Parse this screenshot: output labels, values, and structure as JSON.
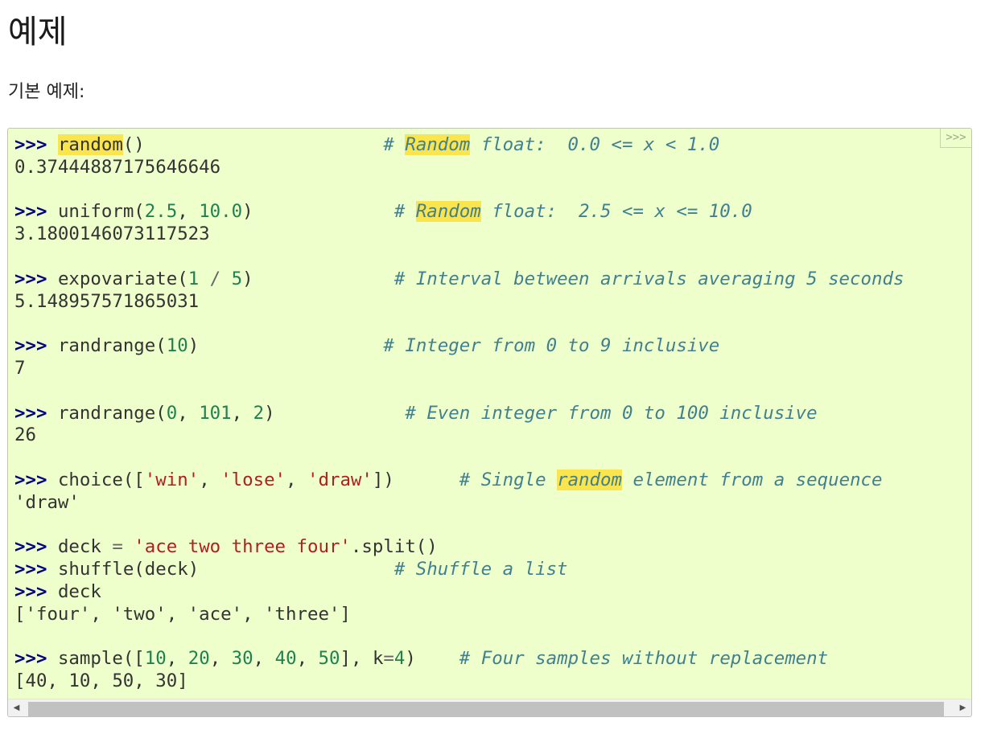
{
  "page": {
    "title": "예제",
    "intro": "기본 예제:"
  },
  "code": {
    "copy_toggle": ">>>",
    "prompt": ">>>",
    "lines": {
      "l1_call": "random",
      "l1_paren": "()",
      "l1_comment_hash": "# ",
      "l1_comment_hl": "Random",
      "l1_comment_rest": " float:  0.0 <= x < 1.0",
      "l1_out": "0.37444887175646646",
      "l2_call": "uniform(",
      "l2_a": "2.5",
      "l2_comma": ", ",
      "l2_b": "10.0",
      "l2_close": ")",
      "l2_comment_hash": "# ",
      "l2_comment_hl": "Random",
      "l2_comment_rest": " float:  2.5 <= x <= 10.0",
      "l2_out": "3.1800146073117523",
      "l3_call": "expovariate(",
      "l3_a": "1",
      "l3_op": " / ",
      "l3_b": "5",
      "l3_close": ")",
      "l3_comment": "# Interval between arrivals averaging 5 seconds",
      "l3_out": "5.148957571865031",
      "l4_call": "randrange(",
      "l4_a": "10",
      "l4_close": ")",
      "l4_comment": "# Integer from 0 to 9 inclusive",
      "l4_out": "7",
      "l5_call": "randrange(",
      "l5_a": "0",
      "l5_c1": ", ",
      "l5_b": "101",
      "l5_c2": ", ",
      "l5_c": "2",
      "l5_close": ")",
      "l5_comment": "# Even integer from 0 to 100 inclusive",
      "l5_out": "26",
      "l6_call": "choice([",
      "l6_s1": "'win'",
      "l6_c1": ", ",
      "l6_s2": "'lose'",
      "l6_c2": ", ",
      "l6_s3": "'draw'",
      "l6_close": "])",
      "l6_comment_hash": "# Single ",
      "l6_comment_hl": "random",
      "l6_comment_rest": " element from a sequence",
      "l6_out": "'draw'",
      "l7_var": "deck ",
      "l7_eq": "=",
      "l7_str": " 'ace two three four'",
      "l7_rest": ".split()",
      "l8_call": "shuffle(deck)",
      "l8_comment": "# Shuffle a list",
      "l9_call": "deck",
      "l9_out": "['four', 'two', 'ace', 'three']",
      "l10_call": "sample([",
      "l10_n1": "10",
      "l10_n2": "20",
      "l10_n3": "30",
      "l10_n4": "40",
      "l10_n5": "50",
      "l10_sep": ", ",
      "l10_k": "], k",
      "l10_eq": "=",
      "l10_kv": "4",
      "l10_close": ")",
      "l10_comment": "# Four samples without replacement",
      "l10_out": "[40, 10, 50, 30]"
    }
  },
  "scrollbar": {
    "left_arrow": "◀",
    "right_arrow": "▶"
  }
}
